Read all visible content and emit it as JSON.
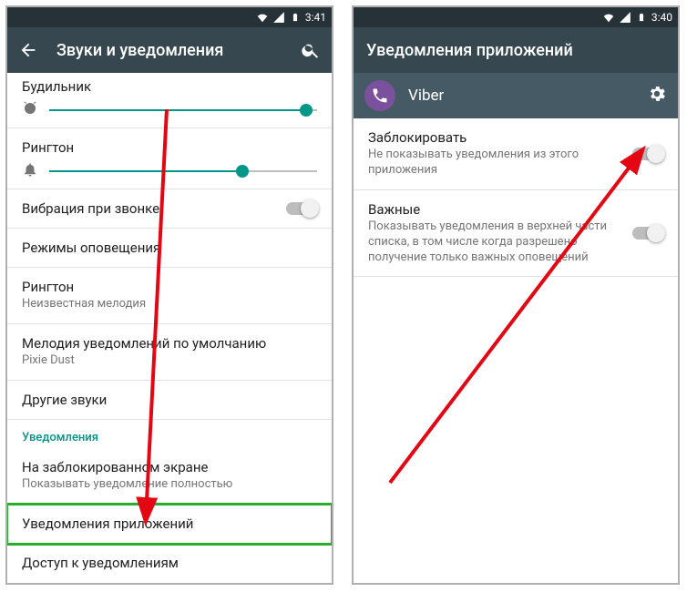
{
  "left": {
    "status_time": "3:41",
    "toolbar_title": "Звуки и уведомления",
    "rows": {
      "alarm_label": "Будильник",
      "ringtone_label": "Рингтон",
      "vibrate_label": "Вибрация при звонке",
      "modes_label": "Режимы оповещения",
      "ringtone2_label": "Рингтон",
      "ringtone2_sub": "Неизвестная мелодия",
      "notif_sound_label": "Мелодия уведомлений по умолчанию",
      "notif_sound_sub": "Pixie Dust",
      "other_sounds_label": "Другие звуки",
      "section_notifications": "Уведомления",
      "lockscreen_label": "На заблокированном экране",
      "lockscreen_sub": "Показывать уведомление полностью",
      "app_notifications_label": "Уведомления приложений",
      "notif_access_label": "Доступ к уведомлениям"
    }
  },
  "right": {
    "status_time": "3:40",
    "toolbar_title": "Уведомления приложений",
    "app_name": "Viber",
    "rows": {
      "block_label": "Заблокировать",
      "block_sub": "Не показывать уведомления из этого приложения",
      "important_label": "Важные",
      "important_sub": "Показывать уведомления в верхней части списка, в том числе когда разрешено получение только важных оповещений"
    }
  }
}
